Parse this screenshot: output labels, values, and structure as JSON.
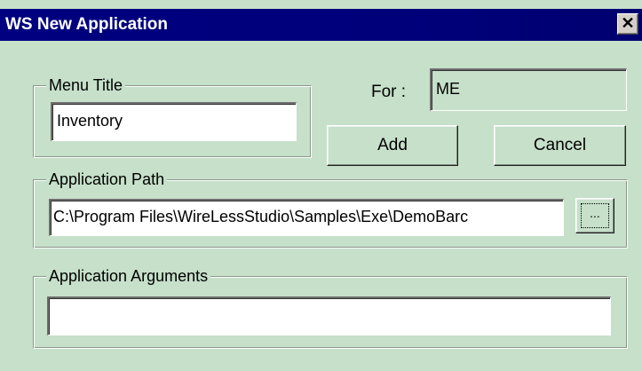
{
  "window": {
    "title": "WS New Application",
    "close_glyph": "✕"
  },
  "menu_title": {
    "legend": "Menu Title",
    "value": "Inventory"
  },
  "for": {
    "label": "For :",
    "value": "ME"
  },
  "buttons": {
    "add_label": "Add",
    "cancel_label": "Cancel",
    "browse_label": "..."
  },
  "application_path": {
    "legend": "Application Path",
    "value": "C:\\Program Files\\WireLessStudio\\Samples\\Exe\\DemoBarc"
  },
  "application_arguments": {
    "legend": "Application Arguments",
    "value": ""
  },
  "colors": {
    "dialog_background": "#c6e0c9",
    "titlebar": "#000080",
    "title_text": "#ffffff"
  }
}
